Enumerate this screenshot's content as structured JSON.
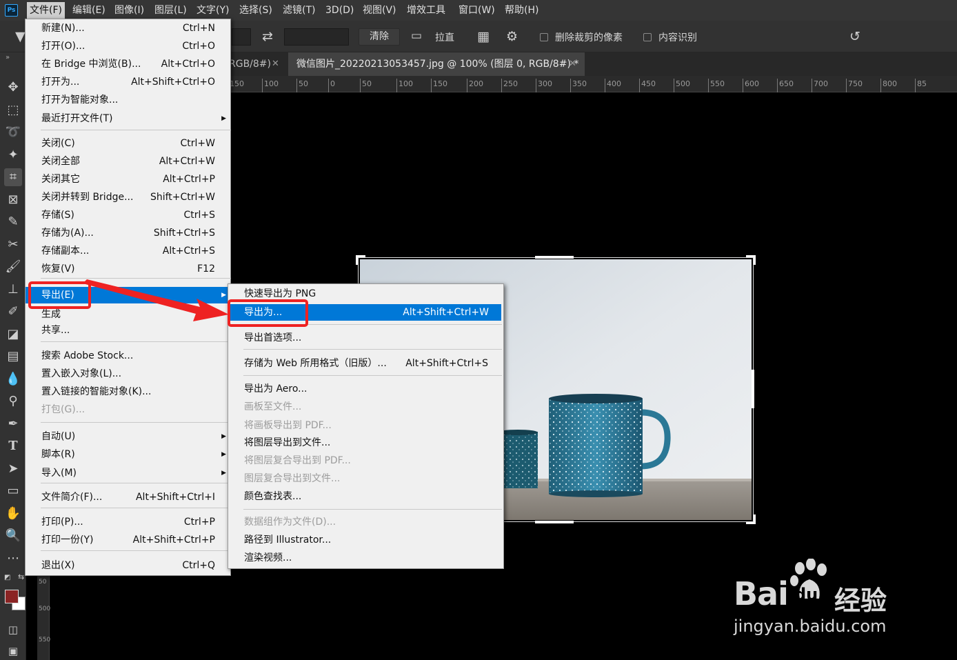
{
  "menubar": {
    "logo": "Ps",
    "items": [
      "文件(F)",
      "编辑(E)",
      "图像(I)",
      "图层(L)",
      "文字(Y)",
      "选择(S)",
      "滤镜(T)",
      "3D(D)",
      "视图(V)",
      "增效工具",
      "窗口(W)",
      "帮助(H)"
    ]
  },
  "options_bar": {
    "clear_label": "清除",
    "straighten_label": "拉直",
    "delete_cropped_label": "删除裁剪的像素",
    "content_aware_label": "内容识别"
  },
  "tabs": [
    {
      "label": "RGB/8#)",
      "active": false
    },
    {
      "label": "微信图片_20220213053457.jpg @ 100% (图层 0, RGB/8#) *",
      "active": true
    }
  ],
  "ruler_ticks": [
    "50",
    "150",
    "100",
    "50",
    "0",
    "50",
    "100",
    "150",
    "200",
    "250",
    "300",
    "350",
    "400",
    "450",
    "500",
    "550",
    "600",
    "650",
    "700",
    "750",
    "800",
    "85"
  ],
  "vruler_ticks": [
    "50",
    "500",
    "550"
  ],
  "file_menu": {
    "items": [
      {
        "label": "新建(N)...",
        "shortcut": "Ctrl+N"
      },
      {
        "label": "打开(O)...",
        "shortcut": "Ctrl+O"
      },
      {
        "label": "在 Bridge 中浏览(B)...",
        "shortcut": "Alt+Ctrl+O"
      },
      {
        "label": "打开为...",
        "shortcut": "Alt+Shift+Ctrl+O"
      },
      {
        "label": "打开为智能对象...",
        "shortcut": ""
      },
      {
        "label": "最近打开文件(T)",
        "shortcut": ""
      },
      {
        "label": "关闭(C)",
        "shortcut": "Ctrl+W"
      },
      {
        "label": "关闭全部",
        "shortcut": "Alt+Ctrl+W"
      },
      {
        "label": "关闭其它",
        "shortcut": "Alt+Ctrl+P"
      },
      {
        "label": "关闭并转到 Bridge...",
        "shortcut": "Shift+Ctrl+W"
      },
      {
        "label": "存储(S)",
        "shortcut": "Ctrl+S"
      },
      {
        "label": "存储为(A)...",
        "shortcut": "Shift+Ctrl+S"
      },
      {
        "label": "存储副本...",
        "shortcut": "Alt+Ctrl+S"
      },
      {
        "label": "恢复(V)",
        "shortcut": "F12"
      },
      {
        "label": "导出(E)",
        "shortcut": ""
      },
      {
        "label": "生成",
        "shortcut": ""
      },
      {
        "label": "共享...",
        "shortcut": ""
      },
      {
        "label": "搜索 Adobe Stock...",
        "shortcut": ""
      },
      {
        "label": "置入嵌入对象(L)...",
        "shortcut": ""
      },
      {
        "label": "置入链接的智能对象(K)...",
        "shortcut": ""
      },
      {
        "label": "打包(G)...",
        "shortcut": ""
      },
      {
        "label": "自动(U)",
        "shortcut": ""
      },
      {
        "label": "脚本(R)",
        "shortcut": ""
      },
      {
        "label": "导入(M)",
        "shortcut": ""
      },
      {
        "label": "文件简介(F)...",
        "shortcut": "Alt+Shift+Ctrl+I"
      },
      {
        "label": "打印(P)...",
        "shortcut": "Ctrl+P"
      },
      {
        "label": "打印一份(Y)",
        "shortcut": "Alt+Shift+Ctrl+P"
      },
      {
        "label": "退出(X)",
        "shortcut": "Ctrl+Q"
      }
    ]
  },
  "export_submenu": {
    "items": [
      {
        "label": "快速导出为 PNG",
        "shortcut": ""
      },
      {
        "label": "导出为...",
        "shortcut": "Alt+Shift+Ctrl+W"
      },
      {
        "label": "导出首选项...",
        "shortcut": ""
      },
      {
        "label": "存储为 Web 所用格式（旧版）...",
        "shortcut": "Alt+Shift+Ctrl+S"
      },
      {
        "label": "导出为 Aero...",
        "shortcut": ""
      },
      {
        "label": "画板至文件...",
        "shortcut": ""
      },
      {
        "label": "将画板导出到 PDF...",
        "shortcut": ""
      },
      {
        "label": "将图层导出到文件...",
        "shortcut": ""
      },
      {
        "label": "将图层复合导出到 PDF...",
        "shortcut": ""
      },
      {
        "label": "图层复合导出到文件...",
        "shortcut": ""
      },
      {
        "label": "颜色查找表...",
        "shortcut": ""
      },
      {
        "label": "数据组作为文件(D)...",
        "shortcut": ""
      },
      {
        "label": "路径到 Illustrator...",
        "shortcut": ""
      },
      {
        "label": "渲染视频...",
        "shortcut": ""
      }
    ]
  },
  "watermark": {
    "brand": "Bai",
    "brand2": "du",
    "cn": "经验",
    "url": "jingyan.baidu.com"
  },
  "colors": {
    "highlight": "#0078d7",
    "annotation_red": "#ee2222",
    "foreground_swatch": "#8b2424",
    "background_swatch": "#ffffff"
  }
}
